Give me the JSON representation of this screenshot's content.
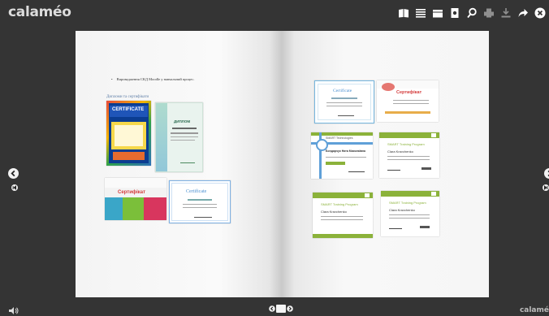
{
  "app": {
    "logo": "calaméo",
    "brand_bottom": "calamé"
  },
  "toolbar": {
    "icons": [
      "book-view-icon",
      "list-icon",
      "grid-icon",
      "document-icon",
      "search-icon",
      "print-icon",
      "download-icon",
      "share-icon",
      "close-icon"
    ]
  },
  "page_left": {
    "bullet_text": "Впровадження СКД Moodle у навчальний процес.",
    "section_title": "Дипломи та сертифікати",
    "certificates": [
      {
        "title": "CERTIFICATE"
      },
      {
        "title": "ДИПЛОМ"
      },
      {
        "title": "Сертифікат"
      },
      {
        "title": "Certificate"
      }
    ]
  },
  "page_right": {
    "certificates": [
      {
        "title": "Certificate"
      },
      {
        "title": "Сертифікат"
      },
      {
        "title": "SMART Technologies",
        "name": "Бондарчук Ната Миколаївна"
      },
      {
        "title": "SMART Training Program",
        "name": "Clara Kravchenko"
      },
      {
        "title": "SMART Training Program",
        "name": "Clara Kravchenko"
      },
      {
        "title": "SMART Training Program",
        "name": "Clara Kravchenko"
      }
    ]
  },
  "colors": {
    "background": "#343434",
    "page": "#f7f7f7",
    "accent_green": "#8bb23a",
    "accent_blue": "#6f9fd6"
  }
}
